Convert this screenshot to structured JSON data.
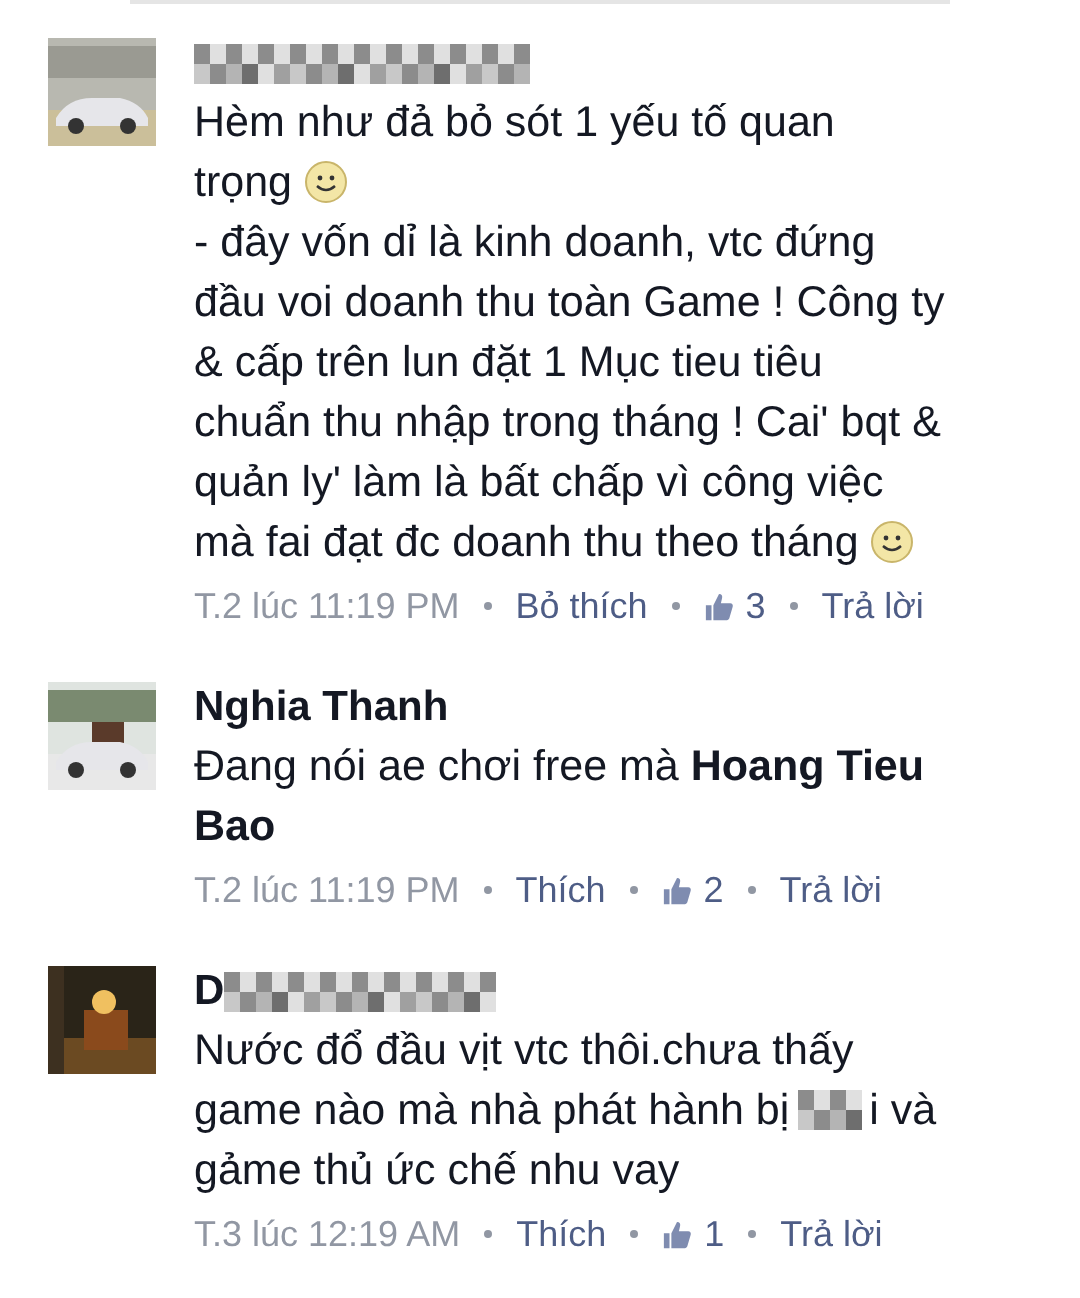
{
  "comments": [
    {
      "name_redacted": true,
      "avatar": {
        "kind": "picture"
      },
      "lines": [
        [
          {
            "kind": "text",
            "text": "Hèm như đả bỏ sót 1 yếu tố quan"
          }
        ],
        [
          {
            "kind": "text",
            "text": "trọng"
          },
          {
            "kind": "smiley"
          }
        ],
        [
          {
            "kind": "text",
            "text": "- đây vốn dỉ là kinh doanh, vtc đứng"
          }
        ],
        [
          {
            "kind": "text",
            "text": "đầu voi doanh thu toàn Game ! Công ty"
          }
        ],
        [
          {
            "kind": "text",
            "text": "& cấp trên lun đặt 1 Mục tieu tiêu"
          }
        ],
        [
          {
            "kind": "text",
            "text": "chuẩn thu nhập trong tháng ! Cai' bqt &"
          }
        ],
        [
          {
            "kind": "text",
            "text": "quản ly' làm là bất chấp vì công việc"
          }
        ],
        [
          {
            "kind": "text",
            "text": "mà fai đạt đc doanh thu theo tháng"
          },
          {
            "kind": "smiley"
          }
        ]
      ],
      "time": "T.2 lúc 11:19 PM",
      "like": "Bỏ thích",
      "likes": "3",
      "reply": "Trả lời"
    },
    {
      "name_redacted": false,
      "name": "Nghia Thanh",
      "avatar": {
        "kind": "picture"
      },
      "lines": [
        [
          {
            "kind": "text",
            "text": "Đang nói ae chơi free mà **Hoang Tieu**"
          }
        ],
        [
          {
            "kind": "text",
            "text": "**Bao**"
          }
        ]
      ],
      "time": "T.2 lúc 11:19 PM",
      "like": "Thích",
      "likes": "2",
      "reply": "Trả lời"
    },
    {
      "name_redacted": true,
      "name": "D",
      "avatar": {
        "kind": "picture"
      },
      "lines": [
        [
          {
            "kind": "text",
            "text": "Nước đổ đầu vịt vtc thôi.chưa thấy"
          }
        ],
        [
          {
            "kind": "text",
            "text": "game nào mà nhà phát hành bị"
          },
          {
            "kind": "redacted"
          },
          {
            "kind": "text",
            "text": "i và"
          }
        ],
        [
          {
            "kind": "text",
            "text": "gảme thủ ức chế nhu vay"
          }
        ]
      ],
      "time": "T.3 lúc 12:19 AM",
      "like": "Thích",
      "likes": "1",
      "reply": "Trả lời"
    }
  ]
}
